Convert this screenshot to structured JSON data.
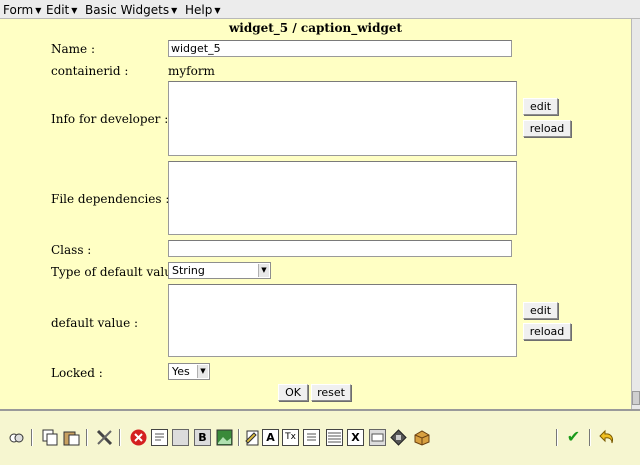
{
  "menu": {
    "form": "Form",
    "edit": "Edit",
    "basic_widgets": "Basic Widgets",
    "help": "Help",
    "arrow": "▼"
  },
  "form": {
    "title": "widget_5 / caption_widget",
    "name_label": "Name :",
    "name_value": "widget_5",
    "containerid_label": "containerid :",
    "containerid_value": "myform",
    "info_label": "Info for developer :",
    "file_deps_label": "File dependencies :",
    "class_label": "Class :",
    "class_value": "",
    "default_type_label": "Type of default value :",
    "default_type_value": "String",
    "default_value_label": "default value :",
    "locked_label": "Locked :",
    "locked_value": "Yes",
    "edit_label": "edit",
    "reload_label": "reload",
    "ok_label": "OK",
    "reset_label": "reset"
  },
  "toolbar": {
    "icons": [
      "undo-redo-icon",
      "copy-icon",
      "paste-icon",
      "tools-icon",
      "delete-icon",
      "text-icon",
      "blank-icon",
      "bold-icon",
      "image-icon",
      "edit-page-icon",
      "caption-icon",
      "text-field-icon",
      "list-icon",
      "table-icon",
      "checkbox-icon",
      "combo-icon",
      "diskette-icon",
      "package-icon",
      "apply-check-icon",
      "undo-icon"
    ],
    "glyph_b": "B",
    "glyph_a": "A",
    "glyph_tx": "Tx",
    "glyph_x": "X",
    "glyph_check": "✔",
    "glyph_cross": "✖"
  },
  "colors": {
    "background": "#ffffc4",
    "menubar": "#ececec",
    "toolbar": "#f6f6d0"
  }
}
